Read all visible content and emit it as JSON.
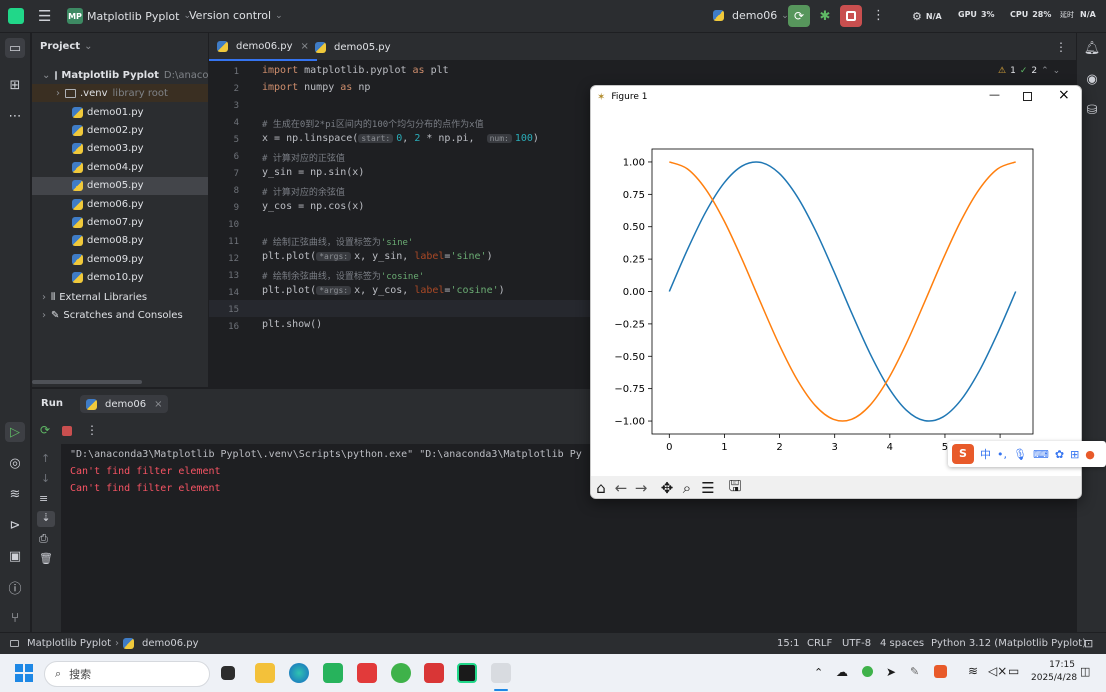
{
  "titlebar": {
    "project_badge": "MP",
    "project_name": "Matplotlib Pyplot",
    "version_control": "Version control",
    "run_config": "demo06",
    "gpu_status": "N/A",
    "gpu_label": "GPU",
    "gpu_value": "3%",
    "cpu_label": "CPU",
    "cpu_value": "28%",
    "na_status": "N/A",
    "bracket_label": "延时"
  },
  "project_panel": {
    "title": "Project",
    "root_name": "Matplotlib Pyplot",
    "root_path": "D:\\anaconda",
    "venv": ".venv",
    "venv_note": "library root",
    "files": [
      "demo01.py",
      "demo02.py",
      "demo03.py",
      "demo04.py",
      "demo05.py",
      "demo06.py",
      "demo07.py",
      "demo08.py",
      "demo09.py",
      "demo10.py"
    ],
    "selected_file": "demo05.py",
    "external_libraries": "External Libraries",
    "scratches": "Scratches and Consoles"
  },
  "editor": {
    "tabs": [
      {
        "label": "demo06.py",
        "active": true
      },
      {
        "label": "demo05.py",
        "active": false
      }
    ],
    "inspection_warnings": "1",
    "inspection_ok": "2",
    "line_numbers": [
      "1",
      "2",
      "3",
      "4",
      "5",
      "6",
      "7",
      "8",
      "9",
      "10",
      "11",
      "12",
      "13",
      "14",
      "15",
      "16"
    ]
  },
  "run_panel": {
    "tab_run": "Run",
    "tab_config": "demo06",
    "command": "\"D:\\anaconda3\\Matplotlib Pyplot\\.venv\\Scripts\\python.exe\" \"D:\\anaconda3\\Matplotlib Py",
    "error1": "Can't find filter element",
    "error2": "Can't find filter element"
  },
  "statusbar": {
    "breadcrumb_project": "Matplotlib Pyplot",
    "breadcrumb_file": "demo06.py",
    "position": "15:1",
    "line_sep": "CRLF",
    "encoding": "UTF-8",
    "indent": "4 spaces",
    "interpreter": "Python 3.12 (Matplotlib Pyplot)"
  },
  "taskbar": {
    "search_placeholder": "搜索",
    "time": "17:15",
    "date": "2025/4/28"
  },
  "figure": {
    "title": "Figure 1",
    "colors": {
      "sine": "#1f77b4",
      "cosine": "#ff7f0e"
    }
  },
  "ime": {
    "mode": "中"
  },
  "chart_data": {
    "type": "line",
    "title": "",
    "xlabel": "",
    "ylabel": "",
    "xlim": [
      -0.314,
      6.597
    ],
    "ylim": [
      -1.1,
      1.1
    ],
    "x_ticks": [
      "0",
      "1",
      "2",
      "3",
      "4",
      "5",
      "6"
    ],
    "y_ticks": [
      "1.00",
      "0.75",
      "0.50",
      "0.25",
      "0.00",
      "−0.25",
      "−0.50",
      "−0.75",
      "−1.00"
    ],
    "grid": false,
    "x": [
      0,
      0.3307,
      0.6614,
      0.9921,
      1.3228,
      1.6535,
      1.9842,
      2.3149,
      2.6456,
      2.9762,
      3.3069,
      3.6376,
      3.9683,
      4.299,
      4.6297,
      4.9604,
      5.2911,
      5.6218,
      5.9525,
      6.2832
    ],
    "series": [
      {
        "name": "sine",
        "values": [
          0,
          0.3247,
          0.6142,
          0.8372,
          0.9694,
          0.9966,
          0.9158,
          0.7357,
          0.4759,
          0.1646,
          -0.1646,
          -0.4759,
          -0.7357,
          -0.9158,
          -0.9966,
          -0.9694,
          -0.8372,
          -0.6142,
          -0.3247,
          0
        ]
      },
      {
        "name": "cosine",
        "values": [
          1,
          0.9458,
          0.7891,
          0.5469,
          0.2455,
          -0.0826,
          -0.4017,
          -0.6773,
          -0.8795,
          -0.9864,
          -0.9864,
          -0.8795,
          -0.6773,
          -0.4017,
          -0.0826,
          0.2455,
          0.5469,
          0.7891,
          0.9458,
          1
        ]
      }
    ]
  }
}
